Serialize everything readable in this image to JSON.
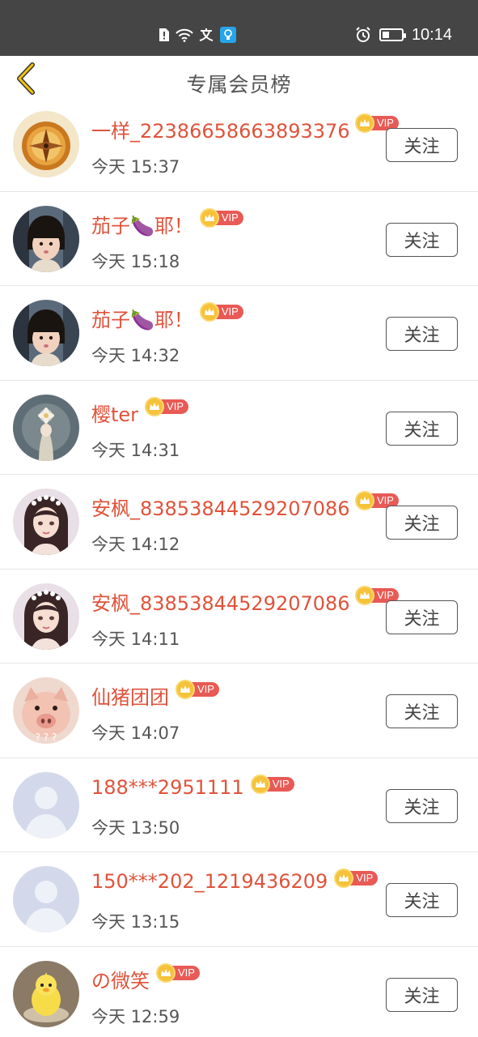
{
  "status_bar": {
    "time": "10:14",
    "left_icons": [
      "sim-alert-icon",
      "wifi-icon",
      "translate-icon",
      "bulb-app-icon"
    ],
    "right_icons": [
      "alarm-icon",
      "battery-icon"
    ],
    "battery_level": 0.35
  },
  "header": {
    "title": "专属会员榜",
    "back_icon": "chevron-left-icon",
    "accent_color": "#e6b400"
  },
  "colors": {
    "name": "#e0533b",
    "vip_tag": "#e85a55",
    "crown": "#f5c23a"
  },
  "members": [
    {
      "name": "一样_22386658663893376",
      "time": "今天 15:37",
      "vip": "VIP",
      "follow": "关注",
      "avatar": "compass-avatar"
    },
    {
      "name": "茄子🍆耶！",
      "time": "今天 15:18",
      "vip": "VIP",
      "follow": "关注",
      "avatar": "child-photo-avatar"
    },
    {
      "name": "茄子🍆耶！",
      "time": "今天 14:32",
      "vip": "VIP",
      "follow": "关注",
      "avatar": "child-photo-avatar"
    },
    {
      "name": "樱ter",
      "time": "今天 14:31",
      "vip": "VIP",
      "follow": "关注",
      "avatar": "flower-avatar"
    },
    {
      "name": "安枫_83853844529207086",
      "time": "今天 14:12",
      "vip": "VIP",
      "follow": "关注",
      "avatar": "anime-girl-avatar"
    },
    {
      "name": "安枫_83853844529207086",
      "time": "今天 14:11",
      "vip": "VIP",
      "follow": "关注",
      "avatar": "anime-girl-avatar"
    },
    {
      "name": "仙猪团团",
      "time": "今天 14:07",
      "vip": "VIP",
      "follow": "关注",
      "avatar": "pig-avatar"
    },
    {
      "name": "188***2951111",
      "time": "今天 13:50",
      "vip": "VIP",
      "follow": "关注",
      "avatar": "default-avatar"
    },
    {
      "name": "150***202_1219436209",
      "time": "今天 13:15",
      "vip": "VIP",
      "follow": "关注",
      "avatar": "default-avatar"
    },
    {
      "name": "の微笑",
      "time": "今天 12:59",
      "vip": "VIP",
      "follow": "关注",
      "avatar": "yellow-duck-avatar"
    }
  ]
}
